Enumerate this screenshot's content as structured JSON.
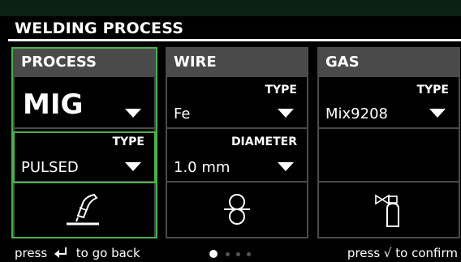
{
  "title": "WELDING PROCESS",
  "process": {
    "header": "PROCESS",
    "value": "MIG",
    "type_label": "TYPE",
    "type_value": "PULSED"
  },
  "wire": {
    "header": "WIRE",
    "type_label": "TYPE",
    "type_value": "Fe",
    "diameter_label": "DIAMETER",
    "diameter_value": "1.0 mm"
  },
  "gas": {
    "header": "GAS",
    "type_label": "TYPE",
    "type_value": "Mix9208"
  },
  "footer": {
    "back_prefix": "press",
    "back_suffix": "to go back",
    "confirm_prefix": "press",
    "confirm_symbol": "√",
    "confirm_suffix": "to confirm"
  },
  "pager": {
    "count": 4,
    "active": 1
  },
  "icons": {
    "process": "welding-torch-icon",
    "wire": "wire-spool-icon",
    "gas": "gas-cylinder-icon"
  },
  "colors": {
    "highlight": "#4caf50",
    "panel": "#4a4a4a",
    "background": "#000000"
  }
}
